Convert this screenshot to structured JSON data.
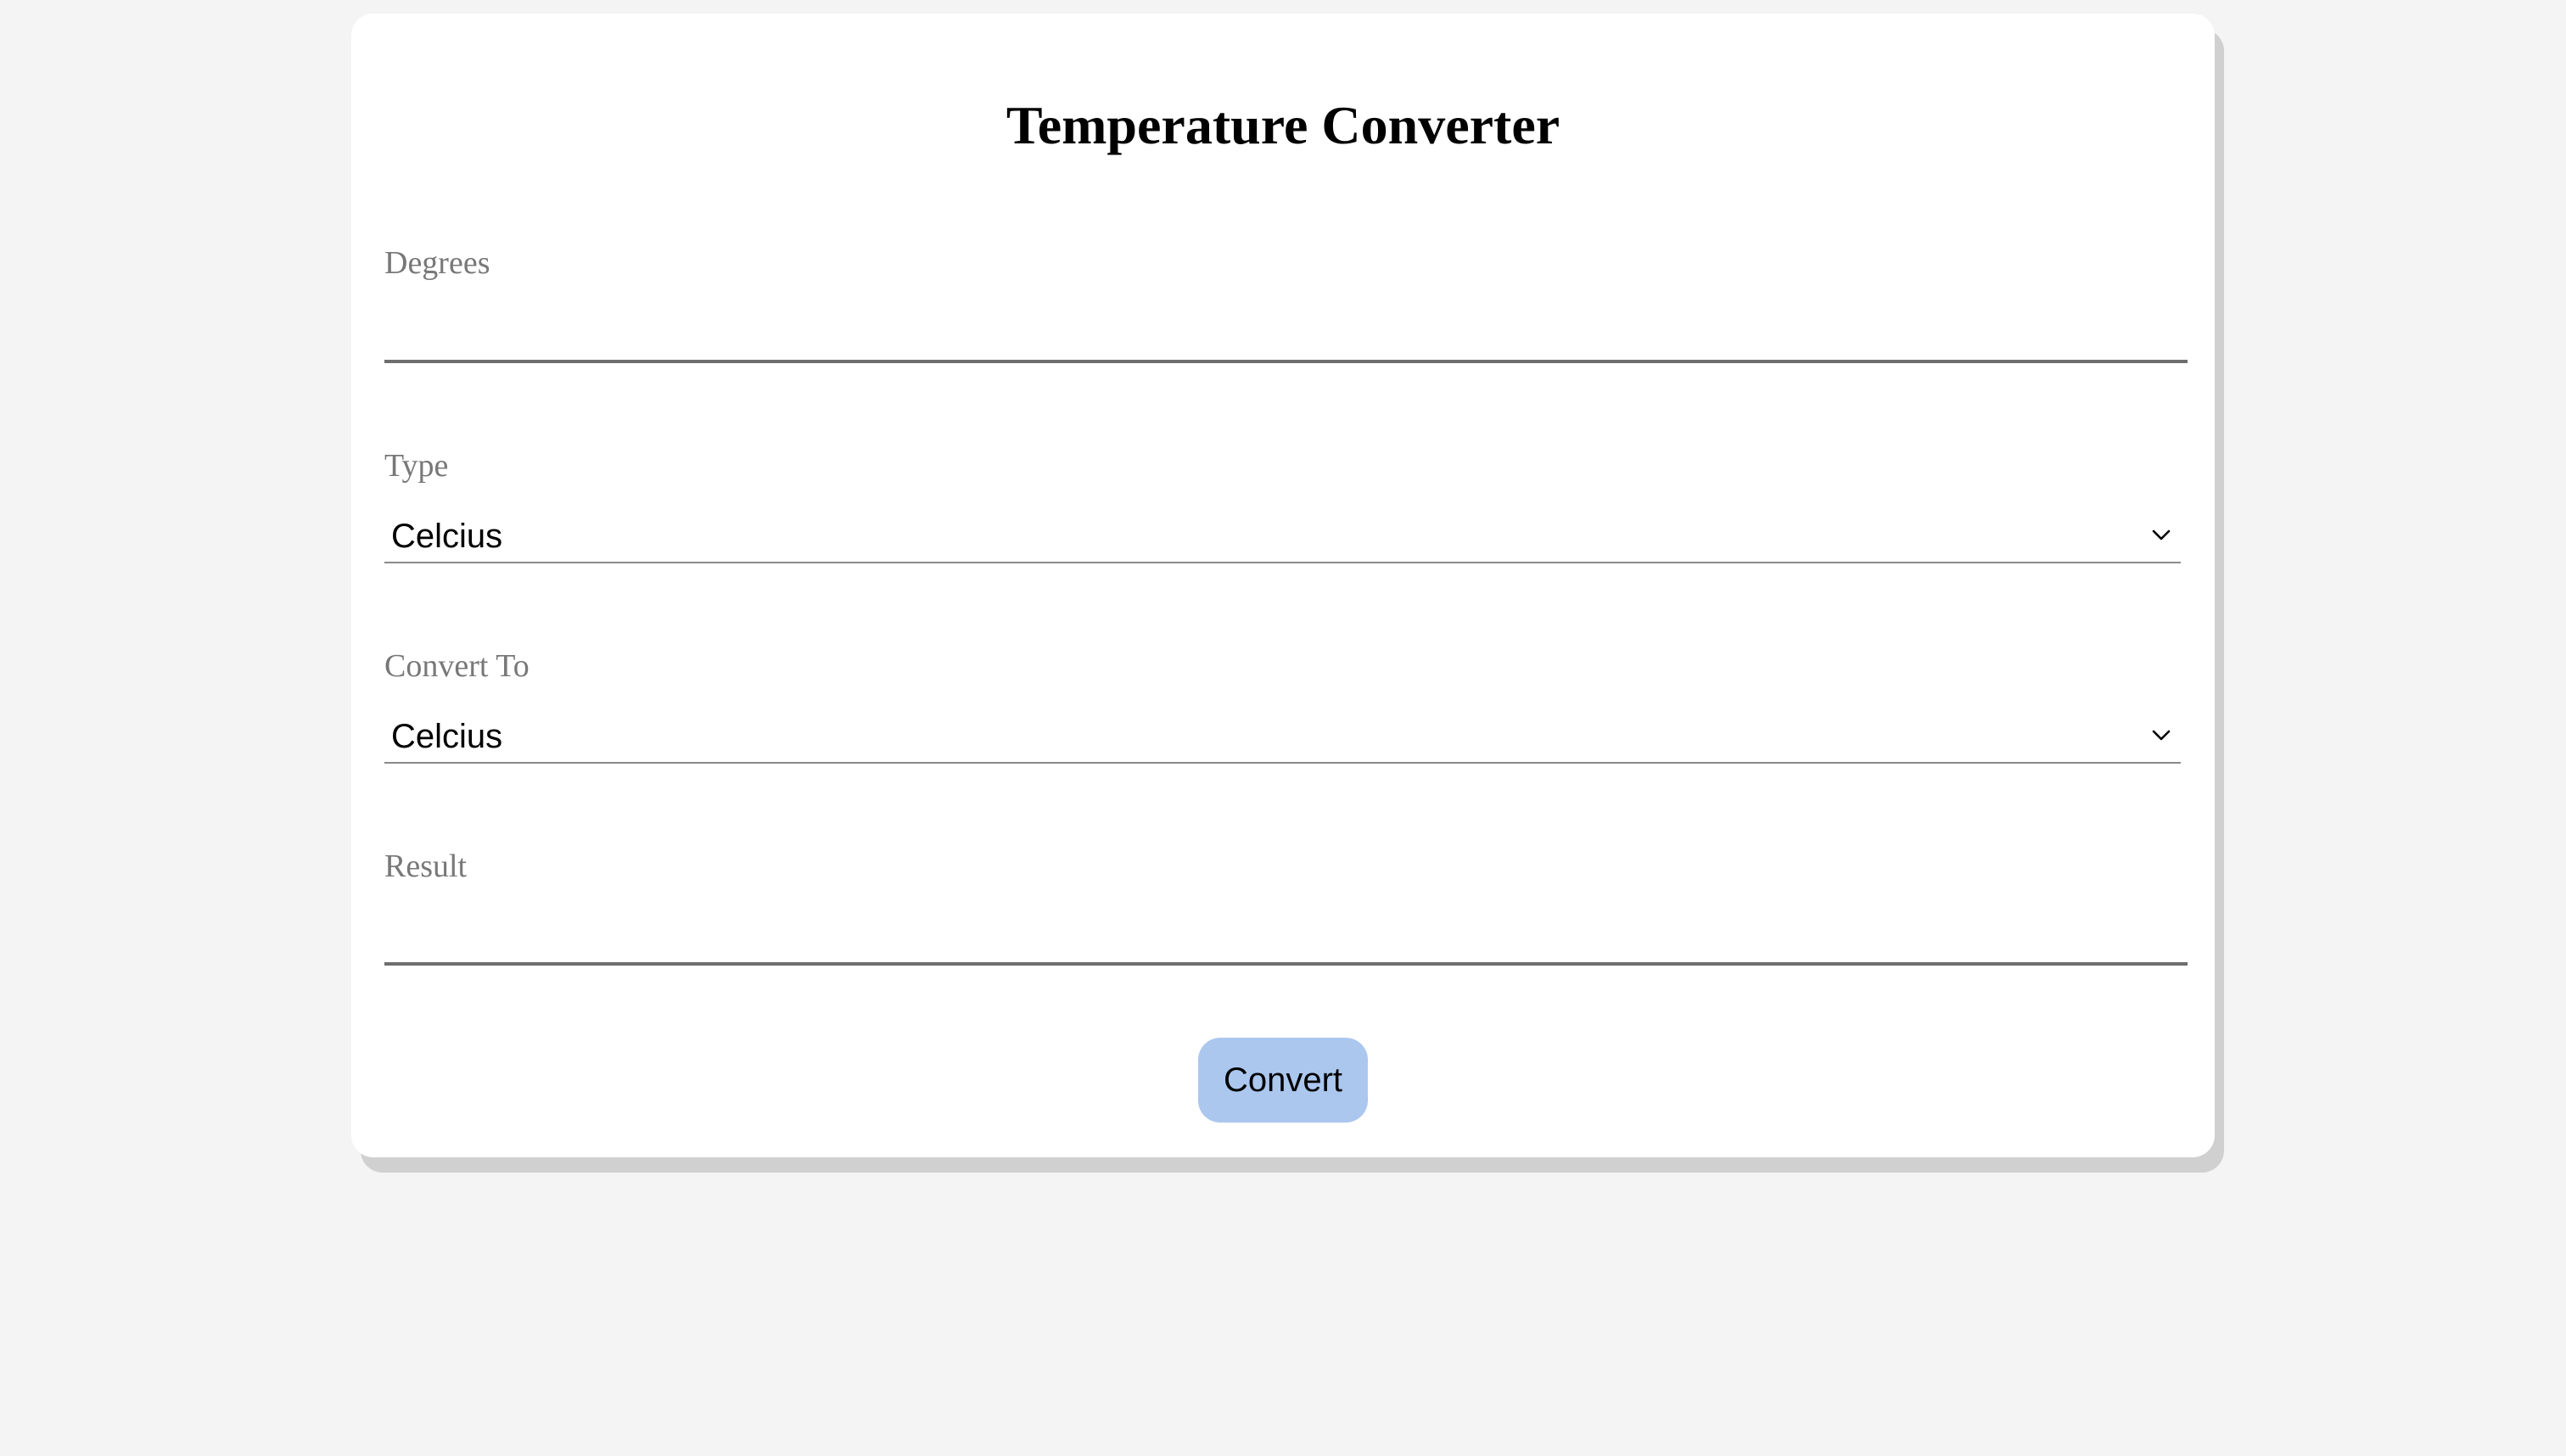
{
  "form": {
    "title": "Temperature Converter",
    "degrees": {
      "label": "Degrees",
      "value": "",
      "placeholder": ""
    },
    "type": {
      "label": "Type",
      "selected": "Celcius"
    },
    "convert_to": {
      "label": "Convert To",
      "selected": "Celcius"
    },
    "result": {
      "label": "Result",
      "value": ""
    },
    "convert_button_label": "Convert"
  },
  "colors": {
    "page_background": "#f4f4f4",
    "card_background": "#ffffff",
    "card_shadow": "#d0d0d0",
    "label_text": "#787878",
    "button_background": "#abc7ee"
  },
  "icons": {
    "select_arrow": "chevron-down-icon"
  }
}
